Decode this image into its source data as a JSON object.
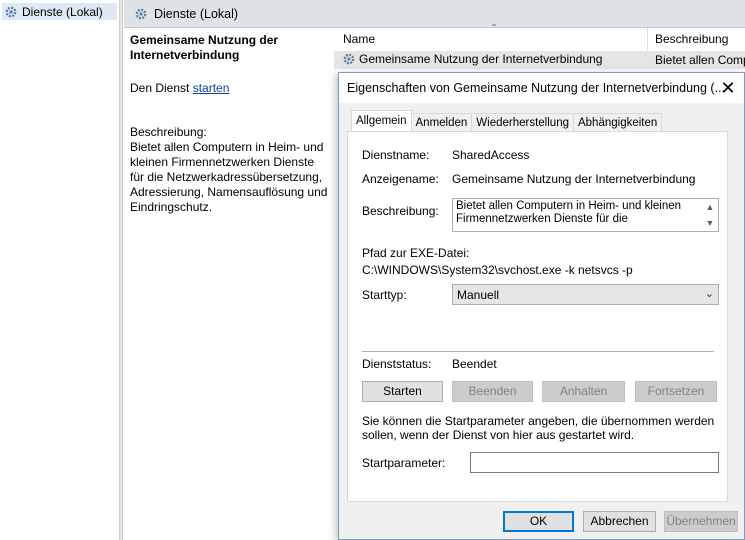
{
  "tree": {
    "root_label": "Dienste (Lokal)"
  },
  "pane": {
    "header_title": "Dienste (Lokal)",
    "service_title": "Gemeinsame Nutzung der Internetverbindung",
    "start_prefix": "Den Dienst ",
    "start_link": "starten",
    "description_label": "Beschreibung:",
    "description_text": "Bietet allen Computern in Heim- und kleinen Firmennetzwerken Dienste für die Netzwerkadressübersetzung, Adressierung, Namensauflösung und Eindringschutz."
  },
  "listview": {
    "columns": [
      "Name",
      "Beschreibung"
    ],
    "rows": [
      {
        "name": "Gemeinsame Nutzung der Internetverbindung",
        "description": "Bietet allen Comp"
      }
    ]
  },
  "dialog": {
    "title": "Eigenschaften von Gemeinsame Nutzung der Internetverbindung (...",
    "close_glyph": "✕",
    "tabs": [
      "Allgemein",
      "Anmelden",
      "Wiederherstellung",
      "Abhängigkeiten"
    ],
    "active_tab": "Allgemein",
    "service_name_label": "Dienstname:",
    "service_name_value": "SharedAccess",
    "display_name_label": "Anzeigename:",
    "display_name_value": "Gemeinsame Nutzung der Internetverbindung",
    "description_label": "Beschreibung:",
    "description_value": "Bietet allen Computern in Heim- und kleinen Firmennetzwerken Dienste für die",
    "exe_path_label": "Pfad zur EXE-Datei:",
    "exe_path_value": "C:\\WINDOWS\\System32\\svchost.exe -k netsvcs -p",
    "start_type_label": "Starttyp:",
    "start_type_value": "Manuell",
    "status_label": "Dienststatus:",
    "status_value": "Beendet",
    "buttons": {
      "start": "Starten",
      "stop": "Beenden",
      "pause": "Anhalten",
      "resume": "Fortsetzen"
    },
    "hint": "Sie können die Startparameter angeben, die übernommen werden sollen, wenn der Dienst von hier aus gestartet wird.",
    "start_params_label": "Startparameter:",
    "start_params_value": "",
    "footer": {
      "ok": "OK",
      "cancel": "Abbrechen",
      "apply": "Übernehmen"
    }
  },
  "colors": {
    "accent": "#0078d7",
    "link": "#0645ad",
    "header_bg": "#dfe3e8"
  },
  "icons": [
    "gear-icon",
    "close-icon",
    "chevron-down-icon",
    "scroll-up-icon",
    "scroll-down-icon",
    "sort-up-icon"
  ]
}
